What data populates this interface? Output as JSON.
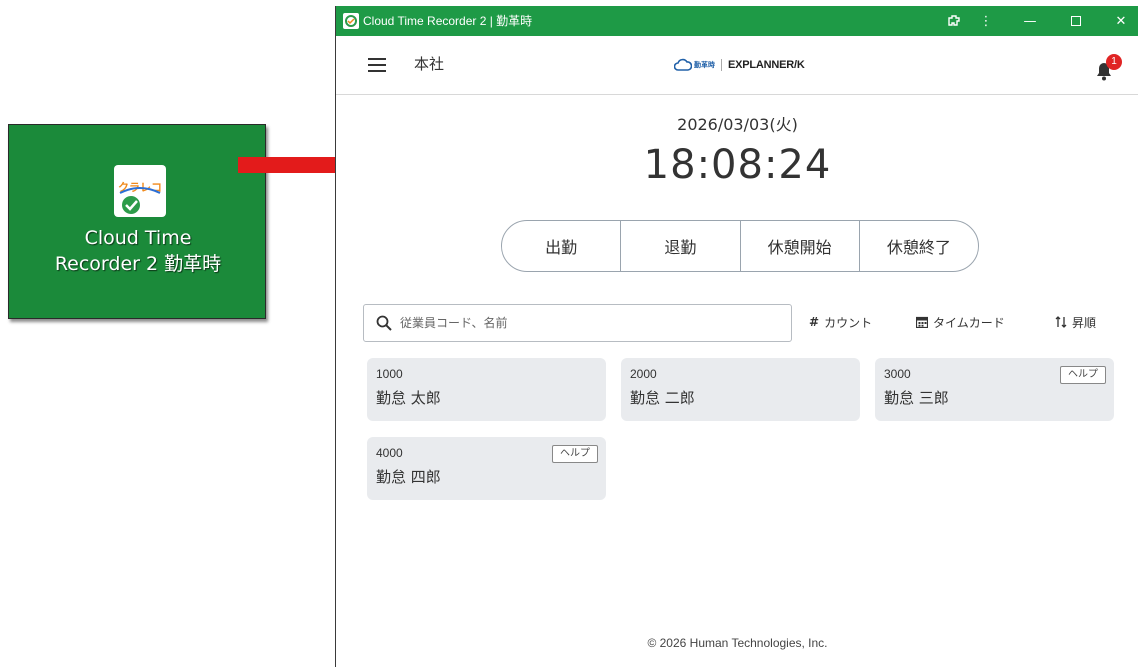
{
  "desktop": {
    "shortcut_label_line1": "Cloud Time",
    "shortcut_label_line2": "Recorder 2  勤革時",
    "icon_text": "クラレコ"
  },
  "window": {
    "title": "Cloud Time Recorder 2 | 勤革時",
    "accent_color": "#1e9a46"
  },
  "header": {
    "store_name": "本社",
    "brand_sub": "勤革時",
    "brand_main": "EXPLANNER/K",
    "notification_count": "1"
  },
  "clock": {
    "date": "2026/03/03(火)",
    "time": "18:08:24"
  },
  "punch_buttons": [
    "出勤",
    "退勤",
    "休憩開始",
    "休憩終了"
  ],
  "search": {
    "placeholder": "従業員コード、名前",
    "value": ""
  },
  "toolbar": {
    "count_label": "カウント",
    "timecard_label": "タイムカード",
    "sort_label": "昇順"
  },
  "employees": [
    {
      "code": "1000",
      "name": "勤怠 太郎",
      "tag": ""
    },
    {
      "code": "2000",
      "name": "勤怠 二郎",
      "tag": ""
    },
    {
      "code": "3000",
      "name": "勤怠 三郎",
      "tag": "ヘルプ"
    },
    {
      "code": "4000",
      "name": "勤怠 四郎",
      "tag": "ヘルプ"
    }
  ],
  "footer": {
    "copyright": "© 2026 Human Technologies, Inc."
  }
}
